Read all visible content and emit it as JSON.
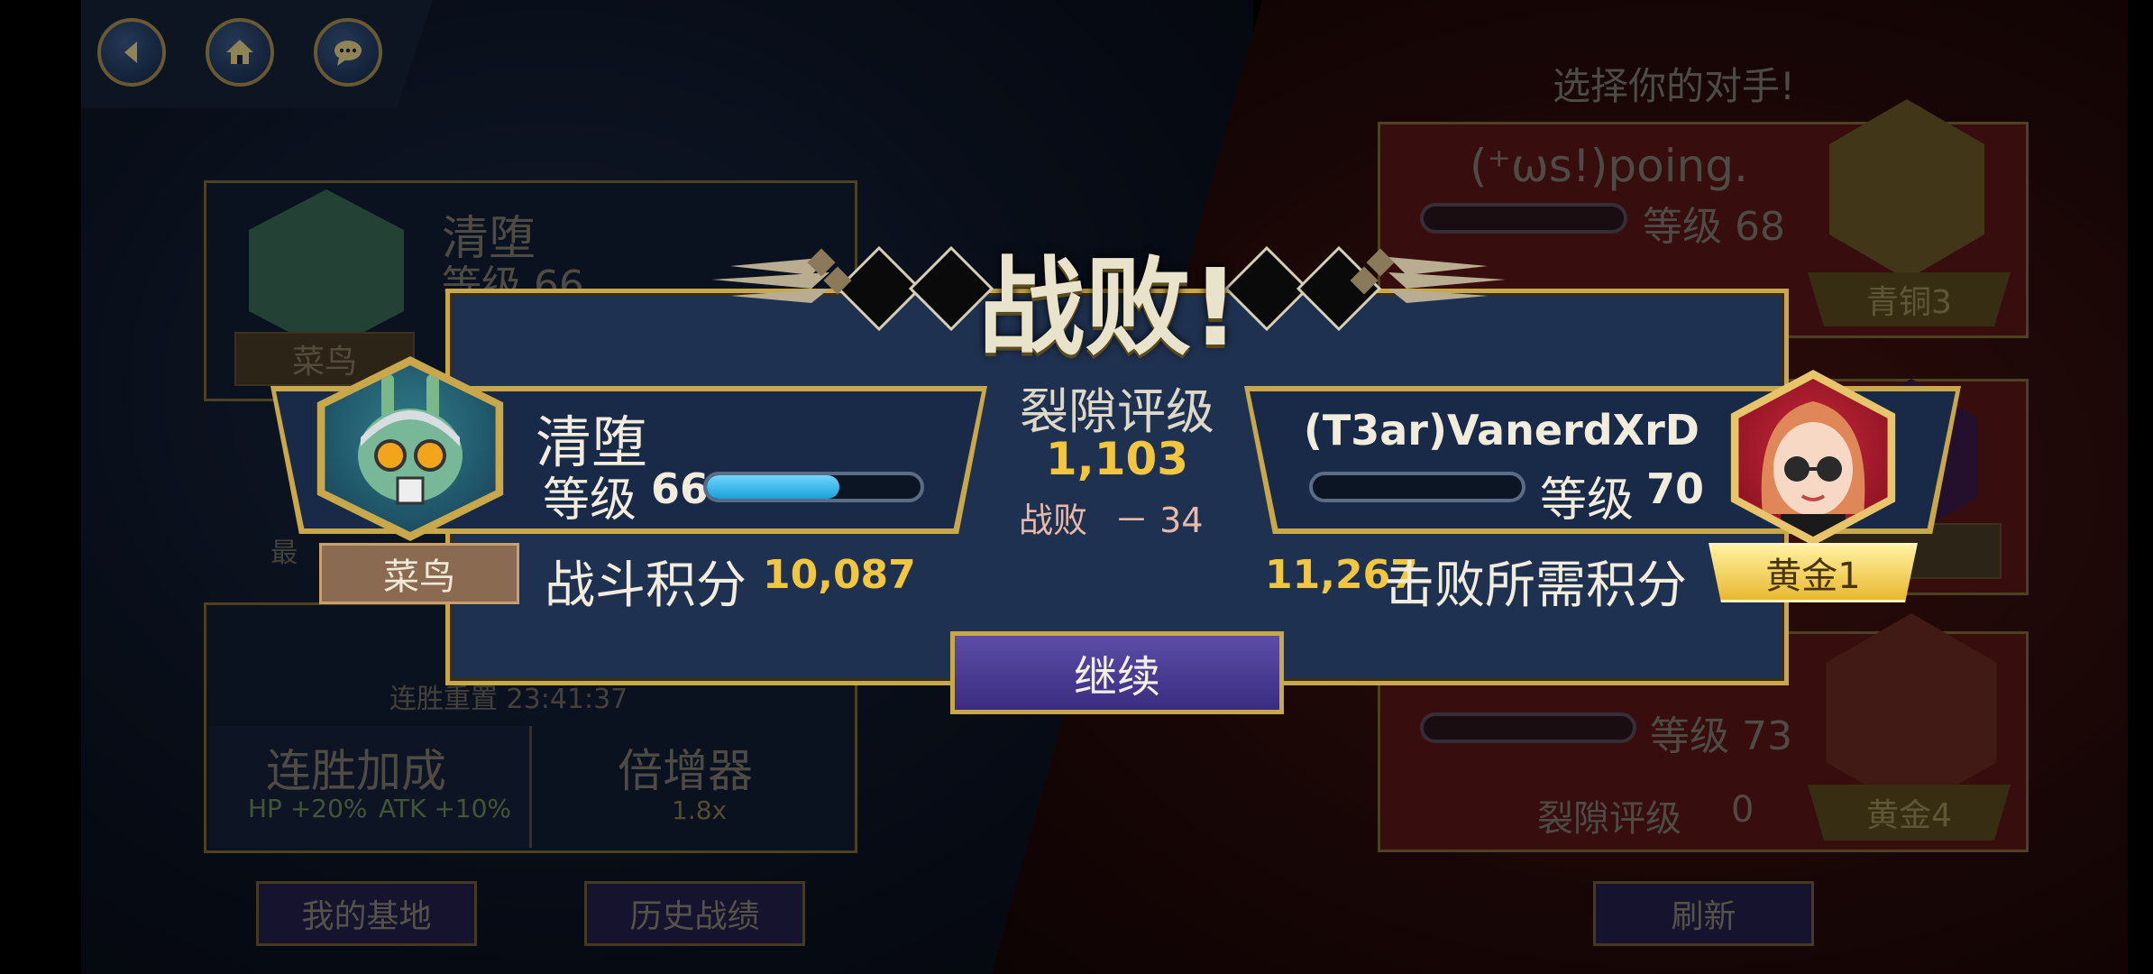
{
  "nav": {
    "back_icon": "back-arrow-icon",
    "home_icon": "home-icon",
    "chat_icon": "chat-bubble-icon"
  },
  "background": {
    "player_card": {
      "name": "清堕",
      "level_label": "等级 66",
      "rank": "菜鸟"
    },
    "streak_reset_text": "连胜重置 23:41:37",
    "streak_bonus_title": "连胜加成",
    "streak_hp": "HP +20%",
    "streak_atk": "ATK +10%",
    "multiplier_title": "倍增器",
    "multiplier_value": "1.8x",
    "my_base_button": "我的基地",
    "history_button": "历史战绩",
    "choose_opponent": "选择你的对手!",
    "opponents": [
      {
        "name": "(⁺ωs!)poing.",
        "level_label": "等级 68",
        "rank": "青铜3"
      },
      {
        "name": "",
        "level_label": "等级 73",
        "rank": "黄金4",
        "rift_label": "裂隙评级",
        "rift_value": "0"
      }
    ],
    "refresh_button": "刷新",
    "partial_left_text": "最"
  },
  "result": {
    "title": "战败!",
    "rift_rating_label": "裂隙评级",
    "rift_rating_value": "1,103",
    "loss_label": "战败",
    "loss_delta": "－ 34",
    "player": {
      "name": "清堕",
      "level_label": "等级",
      "level": "66",
      "level_progress": 0.62,
      "rank": "菜鸟",
      "battle_score_label": "战斗积分",
      "battle_score": "10,087"
    },
    "opponent": {
      "name": "(T3ar)VanerdXrD",
      "level_label": "等级",
      "level": "70",
      "level_progress": 0.0,
      "rank": "黄金1",
      "defeat_score_label": "击败所需积分",
      "defeat_score": "11,267"
    },
    "continue_button": "继续"
  },
  "colors": {
    "gold": "#c9a84c",
    "score_gold": "#f3c640",
    "modal_blue": "#1f3150",
    "button_purple": "#4a3c94",
    "xp_cyan": "#2bb4ea"
  }
}
